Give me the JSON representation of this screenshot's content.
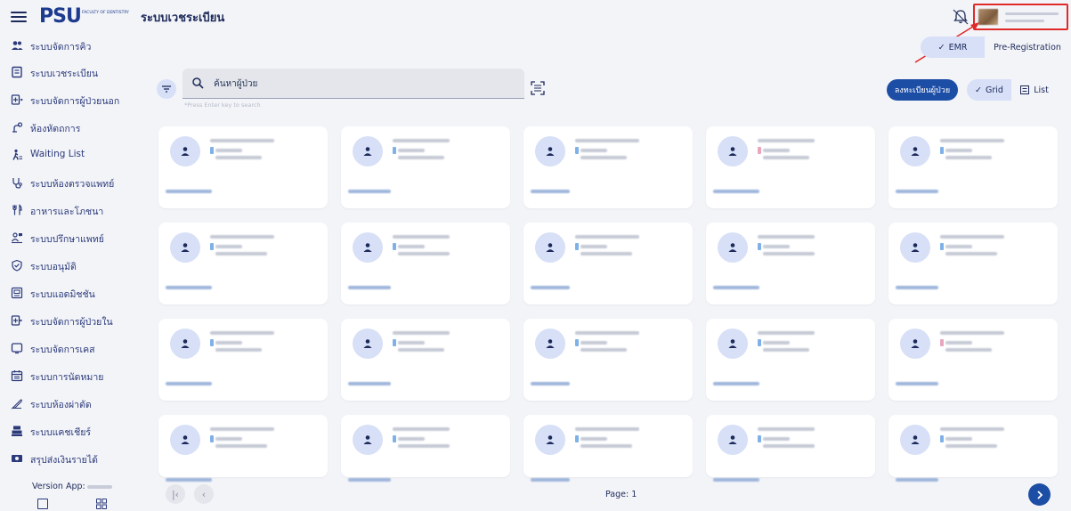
{
  "header": {
    "logo_mark": "PSU",
    "logo_text": "FACULTY OF DENTISTRY",
    "app_title": "ระบบเวชระเบียน",
    "icons": {
      "menu": "hamburger-icon",
      "notifications": "bell-icon"
    }
  },
  "mode_toggle": {
    "emr_label": "EMR",
    "prereg_label": "Pre-Registration",
    "selected": "EMR"
  },
  "sidebar": {
    "items": [
      {
        "label": "ระบบจัดการคิว",
        "icon": "users-icon"
      },
      {
        "label": "ระบบเวชระเบียน",
        "icon": "record-icon"
      },
      {
        "label": "ระบบจัดการผู้ป่วยนอก",
        "icon": "outpatient-icon"
      },
      {
        "label": "ห้องหัตถการ",
        "icon": "procedure-icon"
      },
      {
        "label": "Waiting List",
        "icon": "walking-icon"
      },
      {
        "label": "ระบบห้องตรวจแพทย์",
        "icon": "stethoscope-icon"
      },
      {
        "label": "อาหารและโภชนา",
        "icon": "food-icon"
      },
      {
        "label": "ระบบปรึกษาแพทย์",
        "icon": "consult-icon"
      },
      {
        "label": "ระบบอนุมัติ",
        "icon": "shield-check-icon"
      },
      {
        "label": "ระบบแอดมิชชัน",
        "icon": "admission-icon"
      },
      {
        "label": "ระบบจัดการผู้ป่วยใน",
        "icon": "inpatient-icon"
      },
      {
        "label": "ระบบจัดการเคส",
        "icon": "case-icon"
      },
      {
        "label": "ระบบการนัดหมาย",
        "icon": "calendar-icon"
      },
      {
        "label": "ระบบห้องผ่าตัด",
        "icon": "scalpel-icon"
      },
      {
        "label": "ระบบแคชเชียร์",
        "icon": "cashier-icon"
      },
      {
        "label": "สรุปส่งเงินรายได้",
        "icon": "money-icon"
      }
    ],
    "version_label": "Version App:"
  },
  "search": {
    "placeholder": "ค้นหาผู้ป่วย",
    "value": "",
    "hint": "*Press Enter key to search"
  },
  "toolbar": {
    "register_label": "ลงทะเบียนผู้ป่วย",
    "grid_label": "Grid",
    "list_label": "List",
    "view_selected": "Grid"
  },
  "patients": {
    "rows": 4,
    "cols": 5,
    "note": "patient names are blurred in the screenshot"
  },
  "pagination": {
    "page_label": "Page: 1"
  },
  "colors": {
    "primary": "#1d4ea5",
    "accent_light": "#d7e0f7",
    "background": "#f3f4f8",
    "highlight_box": "#e02a2a"
  }
}
